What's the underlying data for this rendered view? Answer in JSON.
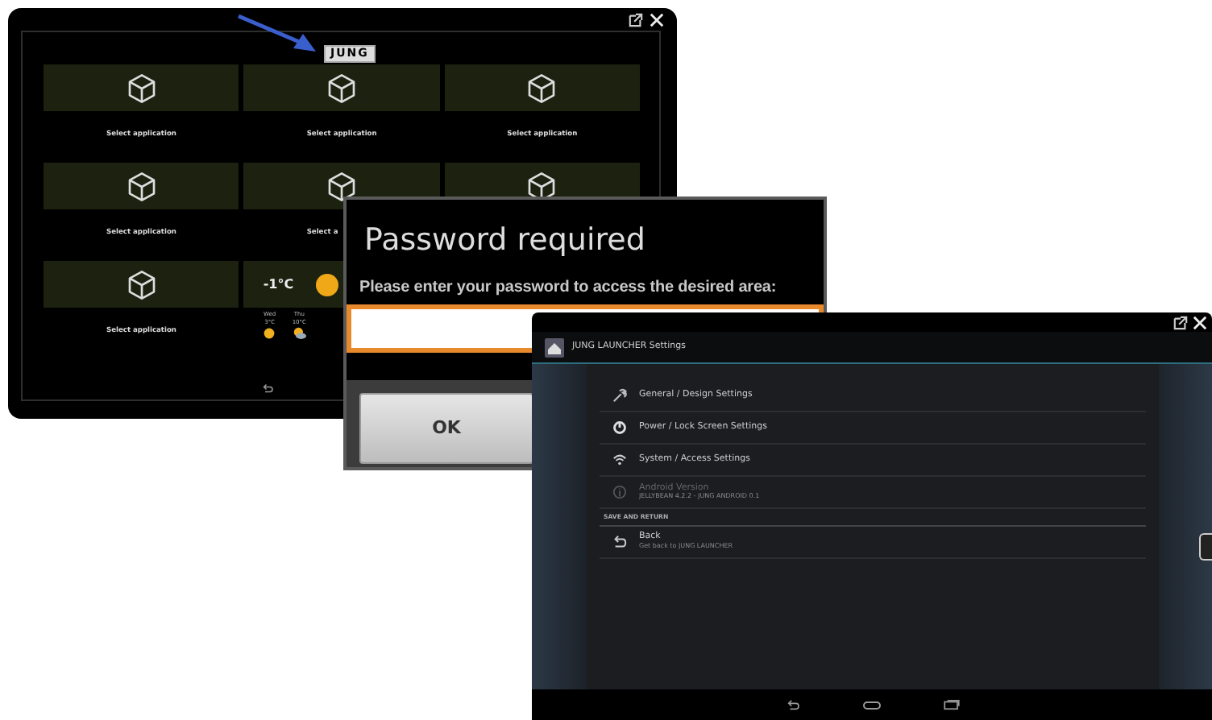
{
  "launcher": {
    "logo": "JUNG",
    "tiles": [
      {
        "kind": "app",
        "label": "Select application"
      },
      {
        "kind": "app",
        "label": "Select application"
      },
      {
        "kind": "app",
        "label": "Select application"
      },
      {
        "kind": "app",
        "label": "Select application"
      },
      {
        "kind": "app",
        "label": "Select a"
      },
      {
        "kind": "app"
      },
      {
        "kind": "app",
        "label": "Select application"
      },
      {
        "kind": "weather",
        "temperature": "-1°C",
        "forecast": [
          {
            "day": "Wed",
            "temp": "3°C",
            "kind": "sun"
          },
          {
            "day": "Thu",
            "temp": "10°C",
            "kind": "cloud-sun"
          }
        ]
      }
    ]
  },
  "password_dialog": {
    "title": "Password required",
    "message": "Please enter your password to access the desired area:",
    "field": {
      "focused": true
    },
    "button": "OK"
  },
  "settings": {
    "title": "JUNG LAUNCHER Settings",
    "items": [
      {
        "kind": "wrench",
        "label": "General / Design Settings",
        "disabled": false
      },
      {
        "kind": "power",
        "label": "Power / Lock Screen Settings",
        "disabled": false
      },
      {
        "kind": "wifi",
        "label": "System / Access Settings",
        "disabled": false
      },
      {
        "kind": "info",
        "label": "Android Version",
        "summary": "JELLYBEAN 4.2.2 - JUNG ANDROID 0.1",
        "disabled": true
      }
    ],
    "section": "SAVE AND RETURN",
    "back": {
      "kind": "back",
      "label": "Back",
      "summary": "Get back to JUNG LAUNCHER",
      "disabled": false
    }
  }
}
